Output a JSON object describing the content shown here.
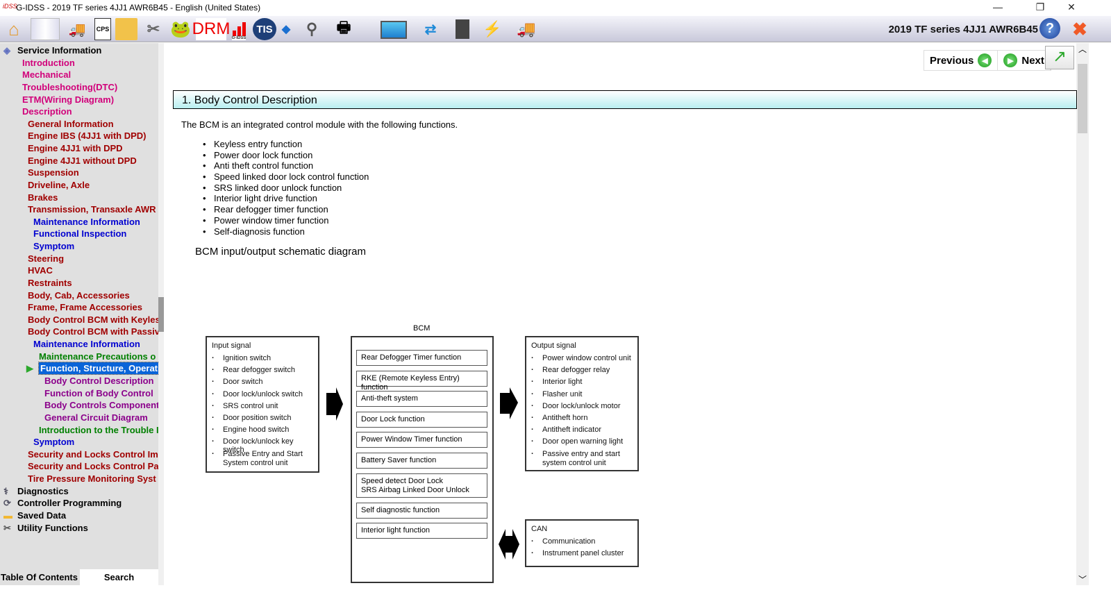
{
  "window": {
    "title": "G-IDSS - 2019 TF series 4JJ1 AWR6B45 - English (United States)",
    "logo": "iDSS",
    "minimize_icon": "minimize-icon",
    "restore_icon": "restore-icon",
    "close_icon": "close-icon"
  },
  "toolbar": {
    "drm_label": "DRM",
    "tis_label": "TIS",
    "gidss_label": "G-IDSS",
    "cps_label": "CPS",
    "vehicle": "2019 TF series 4JJ1 AWR6B45"
  },
  "sidebar": {
    "items": [
      {
        "label": "Service Information",
        "cls": "l0",
        "indent": 0
      },
      {
        "label": "Introduction",
        "cls": "mag",
        "indent": 1
      },
      {
        "label": "Mechanical",
        "cls": "mag",
        "indent": 1
      },
      {
        "label": "Troubleshooting(DTC)",
        "cls": "mag",
        "indent": 1
      },
      {
        "label": "ETM(Wiring Diagram)",
        "cls": "mag",
        "indent": 1
      },
      {
        "label": "Description",
        "cls": "mag",
        "indent": 1
      },
      {
        "label": "General Information",
        "cls": "red",
        "indent": 2
      },
      {
        "label": "Engine IBS (4JJ1 with DPD)",
        "cls": "red",
        "indent": 2
      },
      {
        "label": "Engine 4JJ1 with DPD",
        "cls": "red",
        "indent": 2
      },
      {
        "label": "Engine 4JJ1 without DPD",
        "cls": "red",
        "indent": 2
      },
      {
        "label": "Suspension",
        "cls": "red",
        "indent": 2
      },
      {
        "label": "Driveline, Axle",
        "cls": "red",
        "indent": 2
      },
      {
        "label": "Brakes",
        "cls": "red",
        "indent": 2
      },
      {
        "label": "Transmission, Transaxle AWR",
        "cls": "red",
        "indent": 2
      },
      {
        "label": "Maintenance Information",
        "cls": "blue",
        "indent": 3
      },
      {
        "label": "Functional Inspection",
        "cls": "blue",
        "indent": 3
      },
      {
        "label": "Symptom",
        "cls": "blue",
        "indent": 3
      },
      {
        "label": "Steering",
        "cls": "red",
        "indent": 2
      },
      {
        "label": "HVAC",
        "cls": "red",
        "indent": 2
      },
      {
        "label": "Restraints",
        "cls": "red",
        "indent": 2
      },
      {
        "label": "Body, Cab, Accessories",
        "cls": "red",
        "indent": 2
      },
      {
        "label": "Frame, Frame Accessories",
        "cls": "red",
        "indent": 2
      },
      {
        "label": "Body Control BCM with Keyles",
        "cls": "red",
        "indent": 2
      },
      {
        "label": "Body Control BCM with Passiv",
        "cls": "red",
        "indent": 2
      },
      {
        "label": "Maintenance Information",
        "cls": "blue",
        "indent": 3
      },
      {
        "label": "Maintenance Precautions o",
        "cls": "green",
        "indent": 4
      },
      {
        "label": "Function, Structure, Operati",
        "cls": "sel",
        "indent": 4
      },
      {
        "label": "Body Control Description",
        "cls": "purp",
        "indent": 5
      },
      {
        "label": "Function of Body Control",
        "cls": "purp",
        "indent": 5
      },
      {
        "label": "Body Controls Component",
        "cls": "purp",
        "indent": 5
      },
      {
        "label": "General Circuit Diagram",
        "cls": "purp",
        "indent": 5
      },
      {
        "label": "Introduction to the Trouble I",
        "cls": "green",
        "indent": 4
      },
      {
        "label": "Symptom",
        "cls": "blue",
        "indent": 3
      },
      {
        "label": "Security and Locks Control Im",
        "cls": "red",
        "indent": 2
      },
      {
        "label": "Security and Locks Control Pa",
        "cls": "red",
        "indent": 2
      },
      {
        "label": "Tire Pressure Monitoring Syst",
        "cls": "red",
        "indent": 2
      },
      {
        "label": "Diagnostics",
        "cls": "l0",
        "indent": 0
      },
      {
        "label": "Controller Programming",
        "cls": "l0",
        "indent": 0
      },
      {
        "label": "Saved Data",
        "cls": "l0",
        "indent": 0
      },
      {
        "label": "Utility Functions",
        "cls": "l0",
        "indent": 0
      }
    ],
    "tabs": [
      "Table Of Contents",
      "Search"
    ]
  },
  "nav": {
    "previous": "Previous",
    "next": "Next"
  },
  "content": {
    "heading": "1. Body Control Description",
    "intro": "The BCM is an integrated control module with the following functions.",
    "functions": [
      "Keyless entry function",
      "Power door lock function",
      "Anti theft control function",
      "Speed linked door lock control function",
      "SRS linked door unlock function",
      "Interior light drive function",
      "Rear defogger timer function",
      "Power window timer function",
      "Self-diagnosis function"
    ],
    "diagram_label": "BCM input/output schematic diagram"
  },
  "diagram": {
    "bcm_title": "BCM",
    "input": {
      "title": "Input signal",
      "items": [
        "Ignition switch",
        "Rear defogger switch",
        "Door switch",
        "Door lock/unlock switch",
        "SRS control unit",
        "Door position switch",
        "Engine hood switch",
        "Door lock/unlock key switch",
        "Passive Entry and Start System control unit"
      ]
    },
    "bcm_functions": [
      "Rear Defogger Timer function",
      "RKE (Remote Keyless Entry) function",
      "Anti-theft system",
      "Door Lock function",
      "Power Window Timer function",
      "Battery Saver function",
      "Speed detect Door Lock\nSRS Airbag Linked Door Unlock",
      "Self diagnostic function",
      "Interior light function"
    ],
    "output": {
      "title": "Output signal",
      "items": [
        "Power window control unit",
        "Rear defogger relay",
        "Interior light",
        "Flasher unit",
        "Door lock/unlock motor",
        "Antitheft horn",
        "Antitheft indicator",
        "Door open warning light",
        "Passive entry and start system control unit"
      ]
    },
    "can": {
      "title": "CAN",
      "items": [
        "Communication",
        "Instrument panel cluster"
      ]
    }
  }
}
